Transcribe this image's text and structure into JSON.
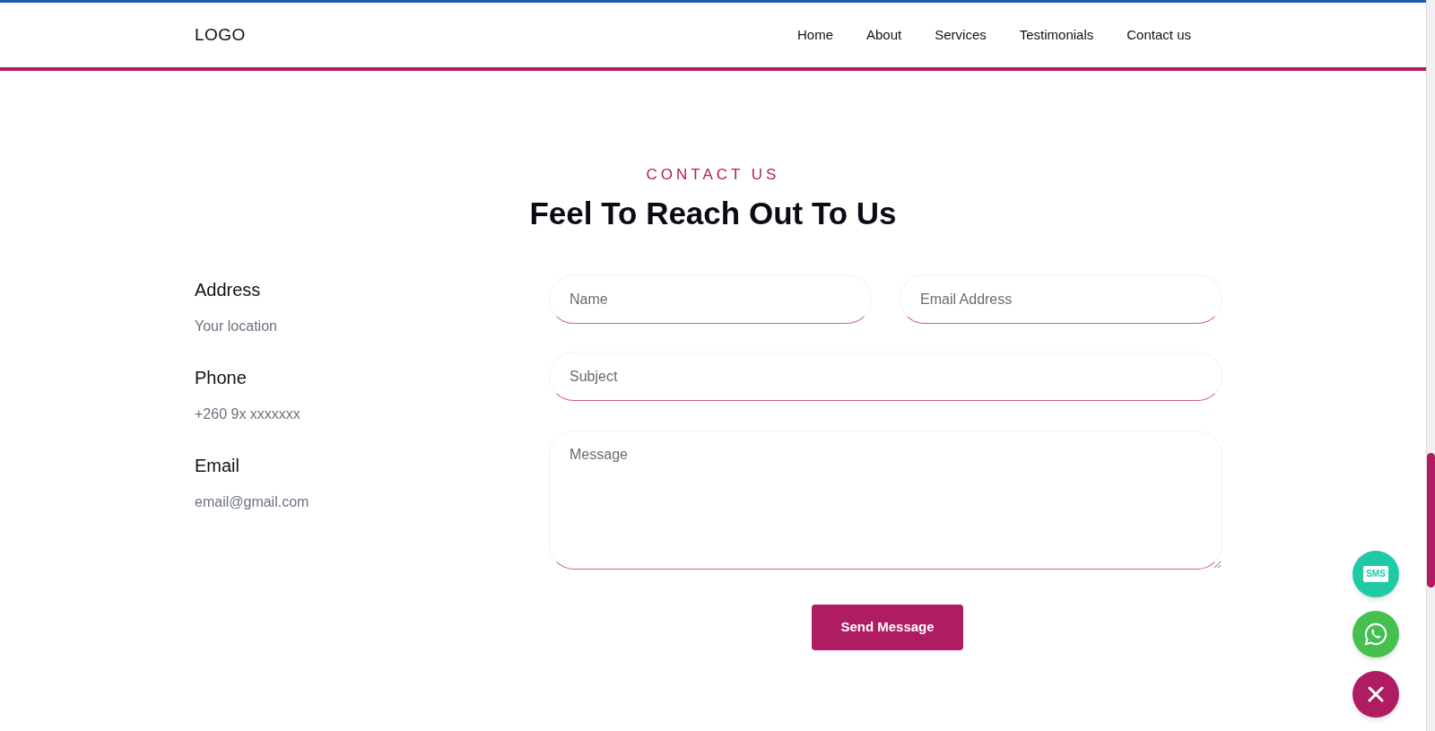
{
  "header": {
    "logo": "LOGO",
    "nav": [
      {
        "label": "Home"
      },
      {
        "label": "About"
      },
      {
        "label": "Services"
      },
      {
        "label": "Testimonials"
      },
      {
        "label": "Contact us"
      }
    ]
  },
  "section": {
    "eyebrow": "CONTACT US",
    "title": "Feel To Reach Out To Us"
  },
  "contact_info": [
    {
      "label": "Address",
      "value": "Your location"
    },
    {
      "label": "Phone",
      "value": "+260 9x xxxxxxx"
    },
    {
      "label": "Email",
      "value": "email@gmail.com"
    }
  ],
  "form": {
    "name": {
      "placeholder": "Name"
    },
    "email": {
      "placeholder": "Email Address"
    },
    "subject": {
      "placeholder": "Subject"
    },
    "message": {
      "placeholder": "Message"
    },
    "submit": "Send Message"
  },
  "floating_buttons": [
    {
      "kind": "sms",
      "label": "SMS"
    },
    {
      "kind": "whatsapp"
    },
    {
      "kind": "close"
    }
  ]
}
